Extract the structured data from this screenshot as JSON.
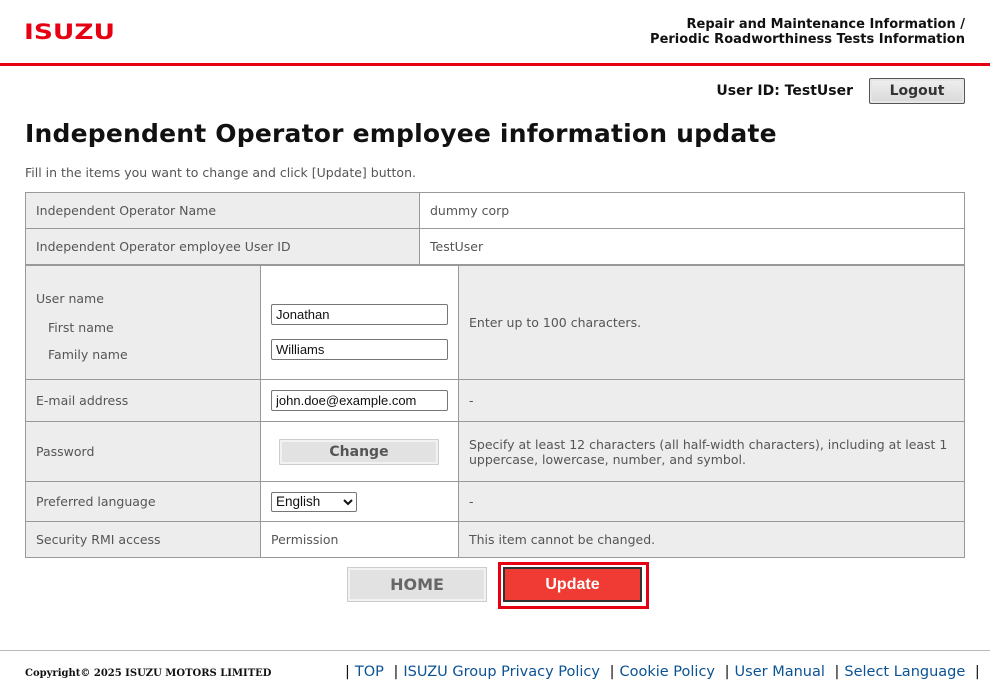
{
  "header": {
    "logo_text": "ISUZU",
    "title_line1": "Repair and Maintenance Information /",
    "title_line2": "Periodic Roadworthiness Tests Information"
  },
  "userbar": {
    "user_id_text": "User ID: TestUser",
    "logout_label": "Logout"
  },
  "page": {
    "title": "Independent Operator employee information update",
    "instruction": "Fill in the items you want to change and click [Update] button."
  },
  "info_table": [
    {
      "label": "Independent Operator Name",
      "value": "dummy corp"
    },
    {
      "label": "Independent Operator employee User ID",
      "value": "TestUser"
    }
  ],
  "form": {
    "user_name": {
      "label": "User name",
      "first_name_label": "First name",
      "first_name_value": "Jonathan",
      "family_name_label": "Family name",
      "family_name_value": "Williams",
      "note": "Enter up to 100 characters."
    },
    "email": {
      "label": "E-mail address",
      "value": "john.doe@example.com",
      "note": "-"
    },
    "password": {
      "label": "Password",
      "button_label": "Change",
      "note": "Specify at least 12 characters (all half-width characters), including at least 1 uppercase, lowercase, number, and symbol."
    },
    "language": {
      "label": "Preferred language",
      "selected": "English",
      "note": "-"
    },
    "rmi": {
      "label": "Security RMI access",
      "value": "Permission",
      "note": "This item cannot be changed."
    }
  },
  "actions": {
    "home_label": "HOME",
    "update_label": "Update"
  },
  "footer": {
    "copyright": "Copyright© 2025 ISUZU MOTORS LIMITED",
    "links": [
      "TOP",
      "ISUZU Group Privacy Policy",
      "Cookie Policy",
      "User Manual",
      "Select Language"
    ],
    "separator": "|"
  },
  "colors": {
    "brand_red": "#e60012",
    "update_red": "#ef3b33",
    "link_blue": "#0b5394"
  }
}
